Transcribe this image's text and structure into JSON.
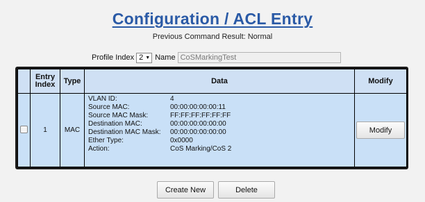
{
  "header": {
    "title": "Configuration / ACL Entry",
    "result": "Previous Command Result: Normal"
  },
  "profile": {
    "index_label": "Profile Index",
    "index_value": "2",
    "name_label": "Name",
    "name_value": "CoSMarkingTest"
  },
  "table": {
    "columns": {
      "entry_index": "Entry Index",
      "type": "Type",
      "data": "Data",
      "modify": "Modify"
    },
    "rows": [
      {
        "entry_index": "1",
        "type": "MAC",
        "fields": [
          {
            "key": "VLAN ID:",
            "value": "4"
          },
          {
            "key": "Source MAC:",
            "value": "00:00:00:00:00:11"
          },
          {
            "key": "Source MAC Mask:",
            "value": "FF:FF:FF:FF:FF:FF"
          },
          {
            "key": "Destination MAC:",
            "value": "00:00:00:00:00:00"
          },
          {
            "key": "Destination MAC Mask:",
            "value": "00:00:00:00:00:00"
          },
          {
            "key": "Ether Type:",
            "value": "0x0000"
          },
          {
            "key": "Action:",
            "value": "CoS Marking/CoS 2"
          }
        ],
        "modify_label": "Modify"
      }
    ]
  },
  "actions": {
    "create_label": "Create New",
    "delete_label": "Delete"
  }
}
